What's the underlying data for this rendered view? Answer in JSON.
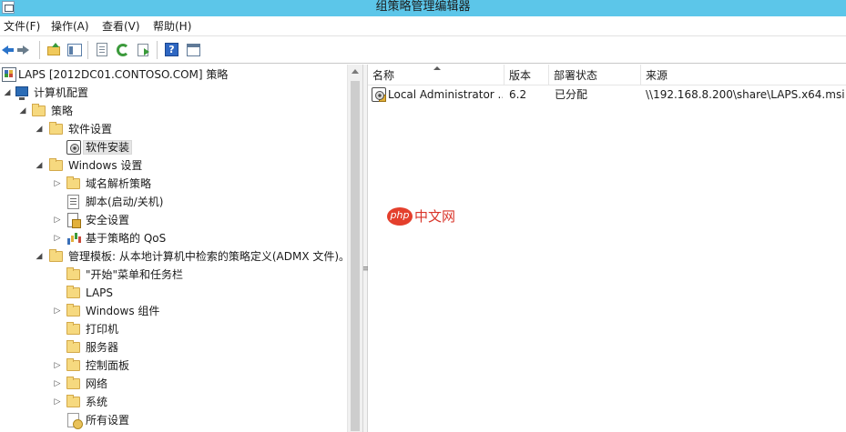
{
  "window": {
    "title": "组策略管理编辑器"
  },
  "menu": [
    "文件(F)",
    "操作(A)",
    "查看(V)",
    "帮助(H)"
  ],
  "toolbar": {
    "icons": [
      "back-arrow-icon",
      "forward-arrow-icon",
      "folder-up-icon",
      "show-hide-tree-icon",
      "properties-icon",
      "refresh-icon",
      "export-list-icon",
      "help-icon",
      "new-window-icon"
    ]
  },
  "tree": {
    "root": "LAPS [2012DC01.CONTOSO.COM] 策略",
    "computer_config": "计算机配置",
    "policies": "策略",
    "software_settings": "软件设置",
    "software_install": "软件安装",
    "windows_settings": "Windows 设置",
    "name_resolution": "域名解析策略",
    "scripts": "脚本(启动/关机)",
    "security_settings": "安全设置",
    "qos": "基于策略的 QoS",
    "admin_templates": "管理模板: 从本地计算机中检索的策略定义(ADMX 文件)。",
    "start_menu": "\"开始\"菜单和任务栏",
    "laps": "LAPS",
    "windows_components": "Windows 组件",
    "printers": "打印机",
    "server": "服务器",
    "control_panel": "控制面板",
    "network": "网络",
    "system": "系统",
    "all_settings": "所有设置"
  },
  "list": {
    "columns": {
      "name": "名称",
      "version": "版本",
      "deploy_state": "部署状态",
      "source": "来源"
    },
    "rows": [
      {
        "name": "Local Administrator ...",
        "version": "6.2",
        "deploy_state": "已分配",
        "source": "\\\\192.168.8.200\\share\\LAPS.x64.msi"
      }
    ]
  },
  "watermark": {
    "logo": "php",
    "text": "中文网"
  },
  "colors": {
    "titlebar": "#5cc6e9",
    "selection": "#e5e5e5",
    "folder": "#f6d97f",
    "watermark": "#e43f2c"
  }
}
